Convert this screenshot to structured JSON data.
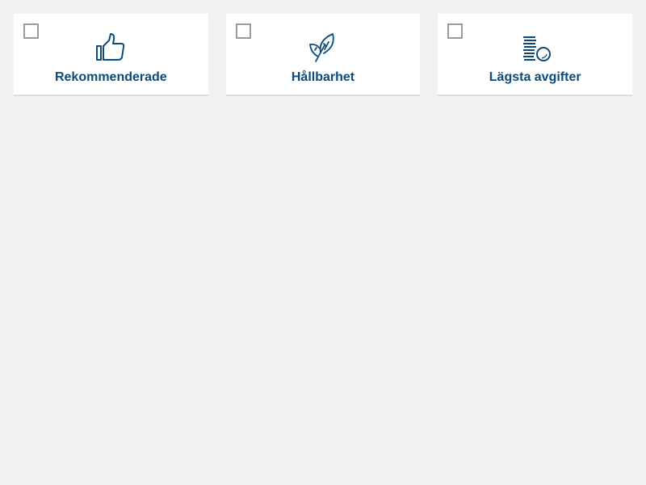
{
  "theme": {
    "accent": "#0b4a7a",
    "background": "#f2f2f2",
    "card": "#ffffff"
  },
  "cards": [
    {
      "label": "Rekommenderade",
      "icon": "thumbs-up-icon",
      "checked": false
    },
    {
      "label": "Hållbarhet",
      "icon": "leaf-icon",
      "checked": false
    },
    {
      "label": "Lägsta avgifter",
      "icon": "coins-icon",
      "checked": false
    }
  ]
}
